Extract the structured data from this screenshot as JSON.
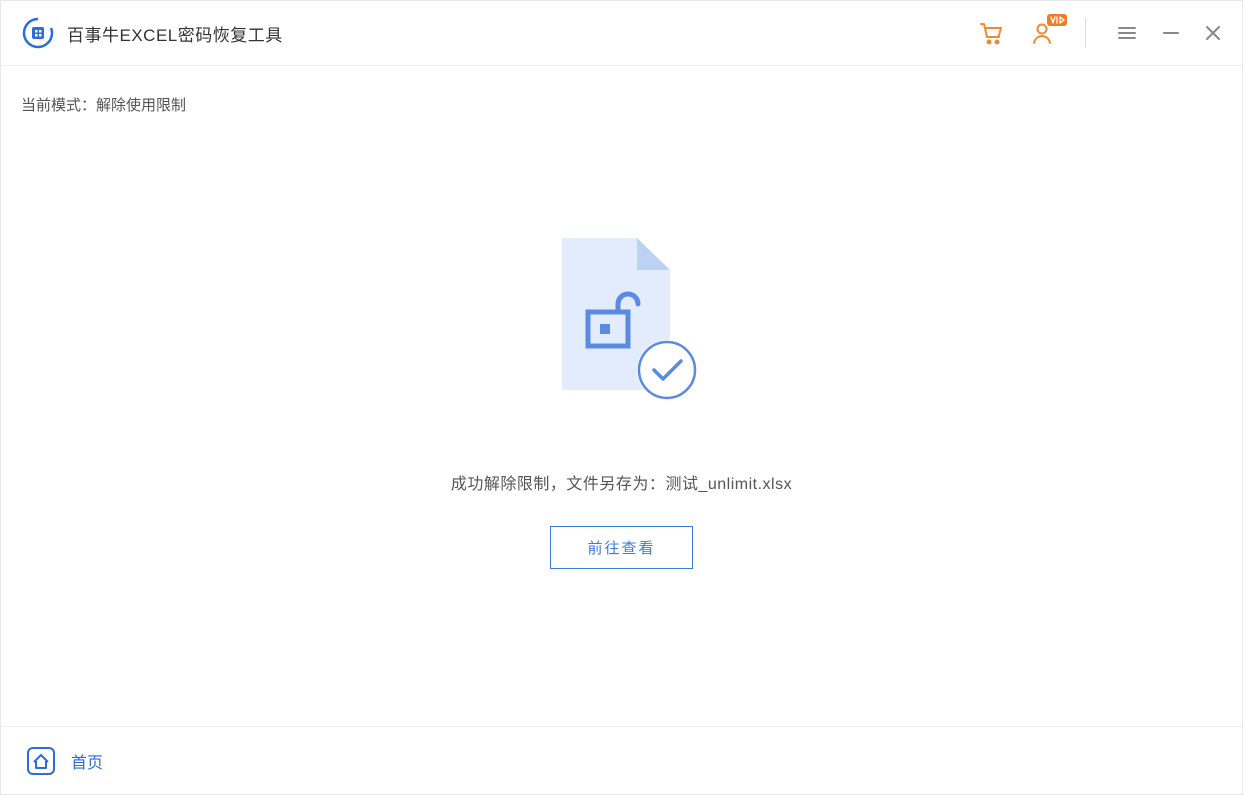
{
  "header": {
    "title": "百事牛EXCEL密码恢复工具"
  },
  "mode": {
    "label": "当前模式：",
    "value": "解除使用限制"
  },
  "result": {
    "message_prefix": "成功解除限制，文件另存为：",
    "filename": "测试_unlimit.xlsx",
    "view_button": "前往查看"
  },
  "footer": {
    "home": "首页"
  }
}
